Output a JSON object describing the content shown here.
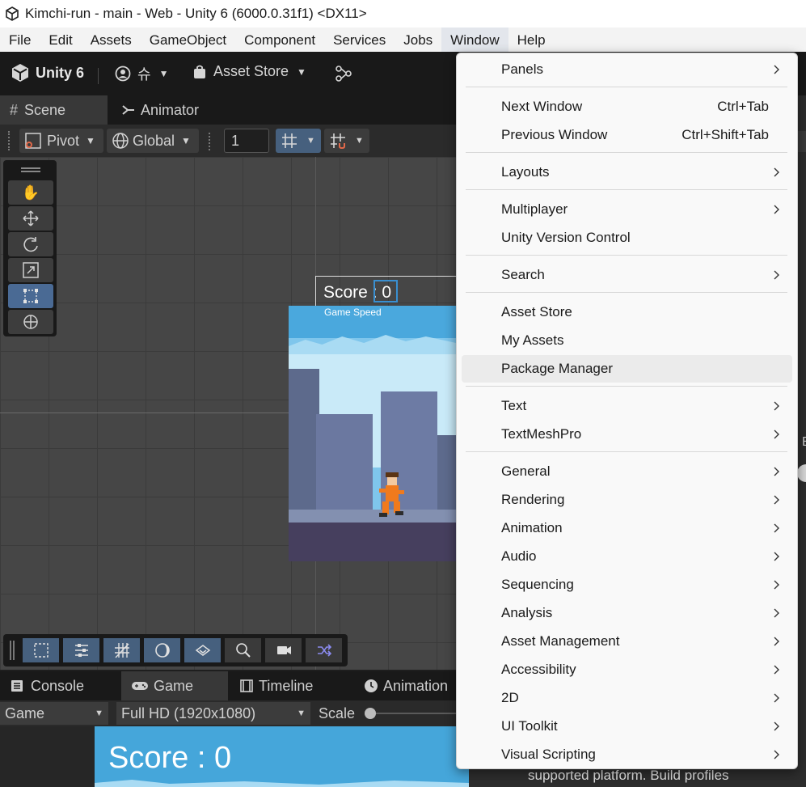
{
  "window": {
    "title": "Kimchi-run - main - Web - Unity 6 (6000.0.31f1) <DX11>"
  },
  "menubar": {
    "items": [
      "File",
      "Edit",
      "Assets",
      "GameObject",
      "Component",
      "Services",
      "Jobs",
      "Window",
      "Help"
    ],
    "active": "Window"
  },
  "toolbar": {
    "unity_label": "Unity 6",
    "account_label": "슈",
    "asset_store_label": "Asset Store"
  },
  "scene_tabs": {
    "scene": "Scene",
    "animator": "Animator"
  },
  "scene_toolbar": {
    "pivot": "Pivot",
    "global": "Global",
    "grid_value": "1"
  },
  "preview": {
    "score": "Score : 0",
    "game_speed": "Game Speed"
  },
  "bottom_tabs": {
    "console": "Console",
    "game": "Game",
    "timeline": "Timeline",
    "animation": "Animation"
  },
  "game_toolbar": {
    "display": "Game",
    "resolution": "Full HD (1920x1080)",
    "scale_label": "Scale"
  },
  "game_view": {
    "score": "Score : 0"
  },
  "window_menu": {
    "panels": "Panels",
    "next_window": "Next Window",
    "next_window_shortcut": "Ctrl+Tab",
    "previous_window": "Previous Window",
    "previous_window_shortcut": "Ctrl+Shift+Tab",
    "layouts": "Layouts",
    "multiplayer": "Multiplayer",
    "unity_version_control": "Unity Version Control",
    "search": "Search",
    "asset_store": "Asset Store",
    "my_assets": "My Assets",
    "package_manager": "Package Manager",
    "text": "Text",
    "textmeshpro": "TextMeshPro",
    "general": "General",
    "rendering": "Rendering",
    "animation": "Animation",
    "audio": "Audio",
    "sequencing": "Sequencing",
    "analysis": "Analysis",
    "asset_management": "Asset Management",
    "accessibility": "Accessibility",
    "two_d": "2D",
    "ui_toolkit": "UI Toolkit",
    "visual_scripting": "Visual Scripting"
  },
  "inspector": {
    "footer_text": "supported platform. Build profiles"
  },
  "colors": {
    "menu_bg": "#f9f9f9",
    "menu_hover": "#ebebeb",
    "editor_dark": "#191919",
    "selection_blue": "#46607e",
    "game_sky": "#45a6da"
  }
}
